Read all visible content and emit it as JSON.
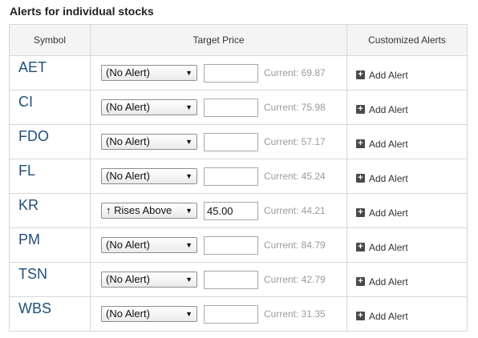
{
  "page": {
    "title": "Alerts for individual stocks"
  },
  "table": {
    "headers": {
      "symbol": "Symbol",
      "target": "Target Price",
      "custom": "Customized Alerts"
    },
    "add_label": "Add Alert",
    "add_icon": "plus-box-icon",
    "rows": [
      {
        "symbol": "AET",
        "alert": "(No Alert)",
        "value": "",
        "current": "Current: 69.87"
      },
      {
        "symbol": "CI",
        "alert": "(No Alert)",
        "value": "",
        "current": "Current: 75.98"
      },
      {
        "symbol": "FDO",
        "alert": "(No Alert)",
        "value": "",
        "current": "Current: 57.17"
      },
      {
        "symbol": "FL",
        "alert": "(No Alert)",
        "value": "",
        "current": "Current: 45.24"
      },
      {
        "symbol": "KR",
        "alert": "↑ Rises Above",
        "value": "45.00",
        "current": "Current: 44.21"
      },
      {
        "symbol": "PM",
        "alert": "(No Alert)",
        "value": "",
        "current": "Current: 84.79"
      },
      {
        "symbol": "TSN",
        "alert": "(No Alert)",
        "value": "",
        "current": "Current: 42.79"
      },
      {
        "symbol": "WBS",
        "alert": "(No Alert)",
        "value": "",
        "current": "Current: 31.35"
      }
    ]
  }
}
